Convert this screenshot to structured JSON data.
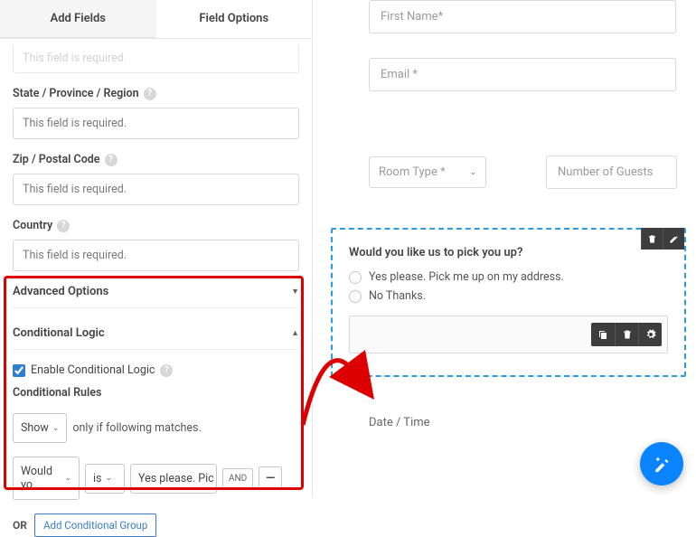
{
  "tabs": {
    "addFields": "Add Fields",
    "fieldOptions": "Field Options"
  },
  "left": {
    "clip": "This field is required.",
    "labels": {
      "state": "State / Province / Region",
      "zip": "Zip / Postal Code",
      "country": "Country"
    },
    "req": "This field is required.",
    "advanced": "Advanced Options",
    "conditional": {
      "title": "Conditional Logic",
      "enable": "Enable Conditional Logic",
      "rules": "Conditional Rules",
      "show": "Show",
      "onlyIf": "only if following matches.",
      "field": "Would yo",
      "op": "is",
      "value": "Yes please. Pic",
      "and": "AND",
      "or": "OR",
      "addGroup": "Add Conditional Group"
    }
  },
  "right": {
    "firstName": "First Name*",
    "email": "Email *",
    "roomType": "Room Type *",
    "guests": "Number of Guests",
    "pickup": {
      "title": "Would you like us to pick you up?",
      "opt1": "Yes please. Pick me up on my address.",
      "opt2": "No Thanks."
    },
    "dateTime": "Date / Time"
  },
  "icons": {
    "help": "?"
  }
}
